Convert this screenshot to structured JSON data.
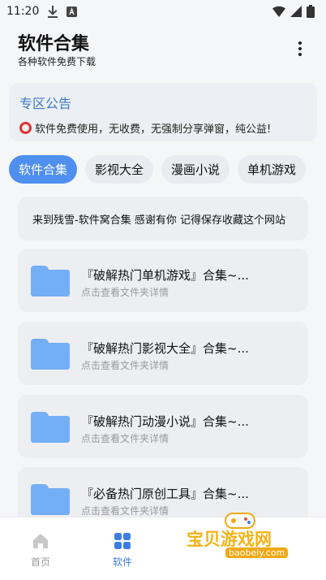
{
  "statusbar": {
    "time": "11:20"
  },
  "header": {
    "title": "软件合集",
    "subtitle": "各种软件免费下载"
  },
  "notice": {
    "title": "专区公告",
    "text": "软件免费使用，无收费，无强制分享弹窗，纯公益!"
  },
  "tabs": [
    {
      "label": "软件合集",
      "active": true
    },
    {
      "label": "影视大全",
      "active": false
    },
    {
      "label": "漫画小说",
      "active": false
    },
    {
      "label": "单机游戏",
      "active": false
    }
  ],
  "banner": {
    "text": "来到残雪-软件窝合集 感谢有你 记得保存收藏这个网站"
  },
  "items": [
    {
      "title": "『破解热门单机游戏』合集~...",
      "subtitle": "点击查看文件夹详情"
    },
    {
      "title": "『破解热门影视大全』合集~...",
      "subtitle": "点击查看文件夹详情"
    },
    {
      "title": "『破解热门动漫小说』合集~...",
      "subtitle": "点击查看文件夹详情"
    },
    {
      "title": "『必备热门原创工具』合集~...",
      "subtitle": "点击查看文件夹详情"
    }
  ],
  "nav": [
    {
      "label": "首页",
      "icon": "home-icon",
      "active": false
    },
    {
      "label": "软件",
      "icon": "grid-icon",
      "active": true
    }
  ],
  "watermark": {
    "text": "宝贝游戏网",
    "url": "baobeiy.com"
  },
  "colors": {
    "accent": "#4e8ff0",
    "notice_title": "#3f78c9",
    "folder": "#74aef5"
  }
}
